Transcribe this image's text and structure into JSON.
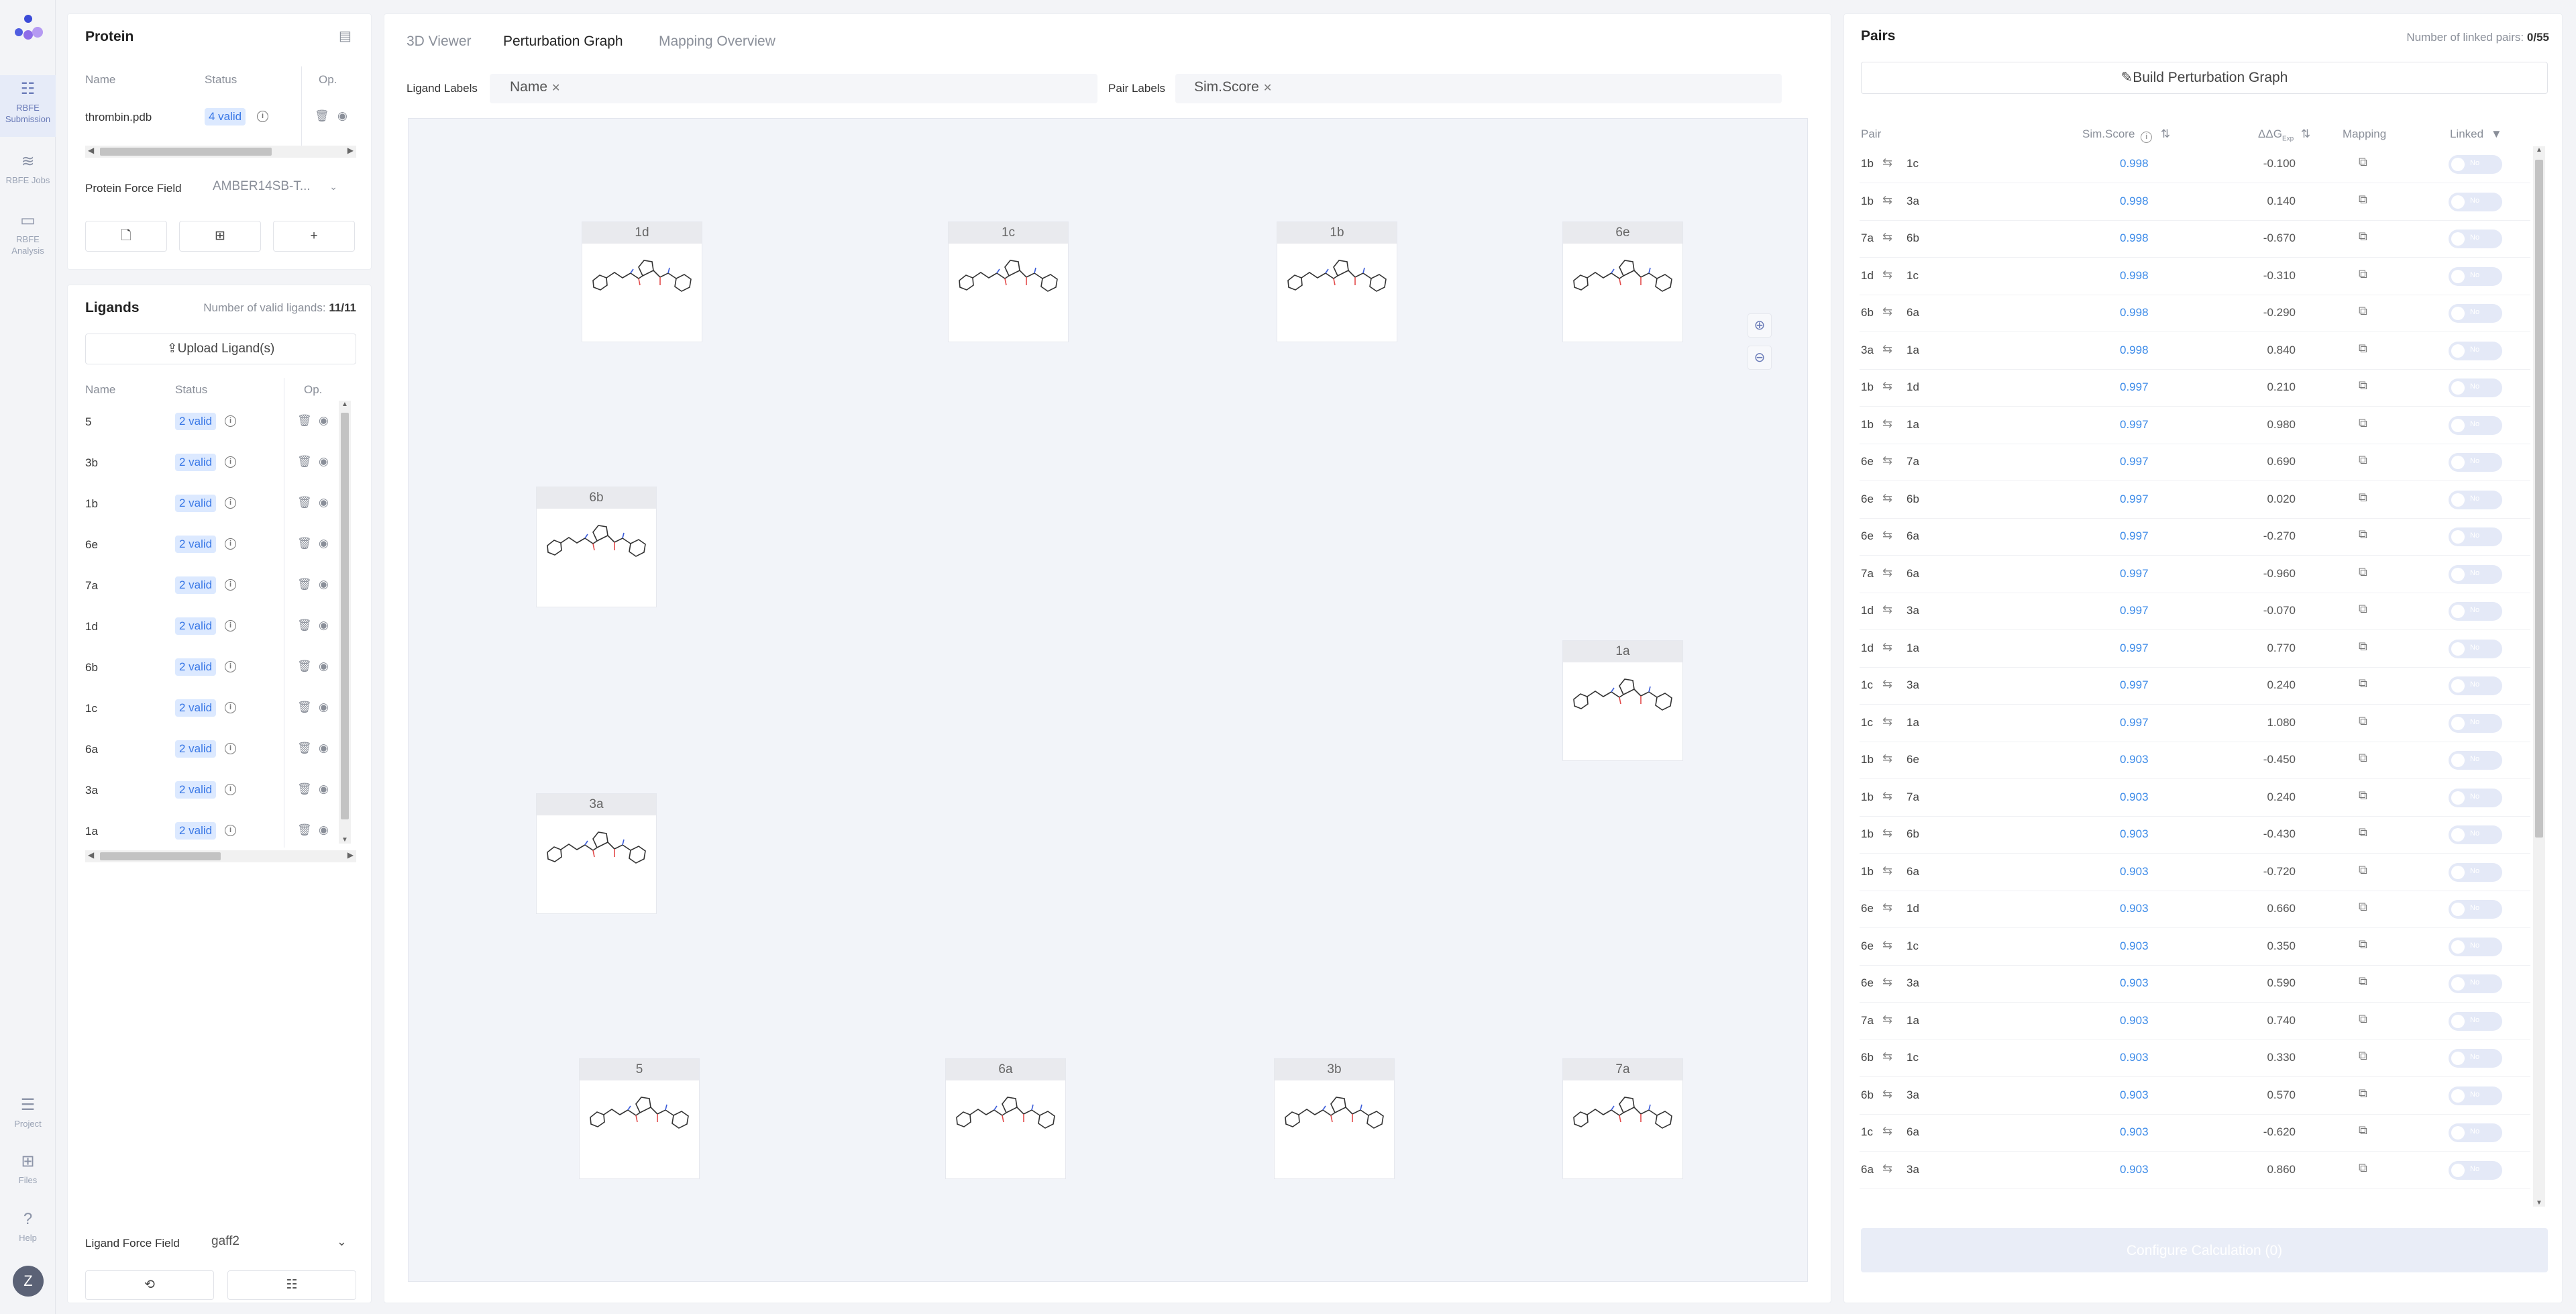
{
  "rail": {
    "items": [
      {
        "label": "RBFE Submission",
        "icon": "sliders-icon",
        "active": true
      },
      {
        "label": "RBFE Jobs",
        "icon": "stack-icon",
        "active": false
      },
      {
        "label": "RBFE Analysis",
        "icon": "monitor-icon",
        "active": false
      },
      {
        "label": "Project",
        "icon": "list-icon",
        "active": false
      },
      {
        "label": "Files",
        "icon": "folder-add-icon",
        "active": false
      },
      {
        "label": "Help",
        "icon": "question-icon",
        "active": false
      }
    ],
    "avatar": "Z"
  },
  "protein": {
    "title": "Protein",
    "col_name": "Name",
    "col_status": "Status",
    "col_op": "Op.",
    "file": "thrombin.pdb",
    "status": "4 valid",
    "ff_label": "Protein Force Field",
    "ff_value": "AMBER14SB-T..."
  },
  "ligands": {
    "title": "Ligands",
    "count_label": "Number of valid ligands:",
    "count_value": "11/11",
    "upload_label": "Upload Ligand(s)",
    "col_name": "Name",
    "col_status": "Status",
    "col_op": "Op.",
    "rows": [
      {
        "name": "5",
        "status": "2 valid"
      },
      {
        "name": "3b",
        "status": "2 valid"
      },
      {
        "name": "1b",
        "status": "2 valid"
      },
      {
        "name": "6e",
        "status": "2 valid"
      },
      {
        "name": "7a",
        "status": "2 valid"
      },
      {
        "name": "1d",
        "status": "2 valid"
      },
      {
        "name": "6b",
        "status": "2 valid"
      },
      {
        "name": "1c",
        "status": "2 valid"
      },
      {
        "name": "6a",
        "status": "2 valid"
      },
      {
        "name": "3a",
        "status": "2 valid"
      },
      {
        "name": "1a",
        "status": "2 valid"
      }
    ],
    "ff_label": "Ligand Force Field",
    "ff_value": "gaff2"
  },
  "center": {
    "tabs": [
      "3D Viewer",
      "Perturbation Graph",
      "Mapping Overview"
    ],
    "active_tab": 1,
    "ligand_labels": "Ligand Labels",
    "ligand_tag": "Name",
    "pair_labels": "Pair Labels",
    "pair_tag": "Sim.Score",
    "nodes": [
      "1d",
      "1c",
      "1b",
      "6e",
      "6b",
      "1a",
      "3a",
      "5",
      "6a",
      "3b",
      "7a"
    ]
  },
  "pairs": {
    "title": "Pairs",
    "linked_label": "Number of linked pairs:",
    "linked_value": "0/55",
    "build_label": "Build Perturbation Graph",
    "col_pair": "Pair",
    "col_score": "Sim.Score",
    "col_ddg": "ΔΔG",
    "col_ddg_sub": "Exp",
    "col_map": "Mapping",
    "col_linked": "Linked",
    "toggle_text": "No",
    "rows": [
      {
        "a": "1b",
        "b": "1c",
        "score": "0.998",
        "ddg": "-0.100"
      },
      {
        "a": "1b",
        "b": "3a",
        "score": "0.998",
        "ddg": "0.140"
      },
      {
        "a": "7a",
        "b": "6b",
        "score": "0.998",
        "ddg": "-0.670"
      },
      {
        "a": "1d",
        "b": "1c",
        "score": "0.998",
        "ddg": "-0.310"
      },
      {
        "a": "6b",
        "b": "6a",
        "score": "0.998",
        "ddg": "-0.290"
      },
      {
        "a": "3a",
        "b": "1a",
        "score": "0.998",
        "ddg": "0.840"
      },
      {
        "a": "1b",
        "b": "1d",
        "score": "0.997",
        "ddg": "0.210"
      },
      {
        "a": "1b",
        "b": "1a",
        "score": "0.997",
        "ddg": "0.980"
      },
      {
        "a": "6e",
        "b": "7a",
        "score": "0.997",
        "ddg": "0.690"
      },
      {
        "a": "6e",
        "b": "6b",
        "score": "0.997",
        "ddg": "0.020"
      },
      {
        "a": "6e",
        "b": "6a",
        "score": "0.997",
        "ddg": "-0.270"
      },
      {
        "a": "7a",
        "b": "6a",
        "score": "0.997",
        "ddg": "-0.960"
      },
      {
        "a": "1d",
        "b": "3a",
        "score": "0.997",
        "ddg": "-0.070"
      },
      {
        "a": "1d",
        "b": "1a",
        "score": "0.997",
        "ddg": "0.770"
      },
      {
        "a": "1c",
        "b": "3a",
        "score": "0.997",
        "ddg": "0.240"
      },
      {
        "a": "1c",
        "b": "1a",
        "score": "0.997",
        "ddg": "1.080"
      },
      {
        "a": "1b",
        "b": "6e",
        "score": "0.903",
        "ddg": "-0.450"
      },
      {
        "a": "1b",
        "b": "7a",
        "score": "0.903",
        "ddg": "0.240"
      },
      {
        "a": "1b",
        "b": "6b",
        "score": "0.903",
        "ddg": "-0.430"
      },
      {
        "a": "1b",
        "b": "6a",
        "score": "0.903",
        "ddg": "-0.720"
      },
      {
        "a": "6e",
        "b": "1d",
        "score": "0.903",
        "ddg": "0.660"
      },
      {
        "a": "6e",
        "b": "1c",
        "score": "0.903",
        "ddg": "0.350"
      },
      {
        "a": "6e",
        "b": "3a",
        "score": "0.903",
        "ddg": "0.590"
      },
      {
        "a": "7a",
        "b": "1a",
        "score": "0.903",
        "ddg": "0.740"
      },
      {
        "a": "6b",
        "b": "1c",
        "score": "0.903",
        "ddg": "0.330"
      },
      {
        "a": "6b",
        "b": "3a",
        "score": "0.903",
        "ddg": "0.570"
      },
      {
        "a": "1c",
        "b": "6a",
        "score": "0.903",
        "ddg": "-0.620"
      },
      {
        "a": "6a",
        "b": "3a",
        "score": "0.903",
        "ddg": "0.860"
      }
    ],
    "configure_label": "Configure Calculation (0)"
  }
}
